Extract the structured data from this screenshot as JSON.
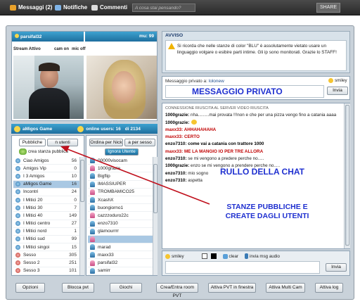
{
  "topbar": {
    "messaggi": "Messaggi (2)",
    "notifiche": "Notifiche",
    "commenti": "Commenti",
    "search_placeholder": "A cosa stai pensando?",
    "share": "SHARE"
  },
  "webcam": {
    "user1": "parsifal32",
    "user2": "mu: 99",
    "stream_label": "Stream Attivo",
    "cam_label": "cam on",
    "mic_label": "mic off"
  },
  "room_bar": {
    "room": "aMigos Game",
    "online_label": "online users: 16",
    "count": "di 2134"
  },
  "tabs": {
    "pubbliche": "Pubbliche",
    "utenti": "n utenti",
    "create_room": "crea stanza pubblica",
    "ordina_nick": "Ordina per Nick",
    "ordina_sesso": "a per sesso",
    "ignora": "Ignora Utente"
  },
  "rooms": [
    {
      "name": "Ciao Amigos",
      "count": "56"
    },
    {
      "name": "Amigos Vip",
      "count": "0"
    },
    {
      "name": "I 3 Amigos",
      "count": "10"
    },
    {
      "name": "aMigos Game",
      "count": "16"
    },
    {
      "name": "Incontri",
      "count": "24"
    },
    {
      "name": "I Mitici 20",
      "count": "0"
    },
    {
      "name": "I Mitici 30",
      "count": "7"
    },
    {
      "name": "I Mitici 40",
      "count": "149"
    },
    {
      "name": "I Mitici centro",
      "count": "27"
    },
    {
      "name": "I Mitici nord",
      "count": "1"
    },
    {
      "name": "I Mitici sud",
      "count": "99"
    },
    {
      "name": "I Mitici singoi",
      "count": "15"
    },
    {
      "name": "Sesso",
      "count": "305"
    },
    {
      "name": "Sesso 2",
      "count": "251"
    },
    {
      "name": "Sesso 3",
      "count": "101"
    }
  ],
  "users": [
    "00000visocam",
    "1000grazie",
    "Bigflip",
    "IMASSIUPER",
    "TROMBAMICO25",
    "XcashX",
    "buongiorno1",
    "cazzzoduro22c",
    "enzo7310",
    "glamourrrr",
    "",
    "marad",
    "maxx33",
    "parsifal32",
    "samirr"
  ],
  "avviso": {
    "title": "AVVISO",
    "text": "Si ricorda che nelle stanze di color \"BLU\" è assolutamente vietato usare un linguaggio volgare o esibire parti intime. Gli ip sono monitorati. Grazie lo STAFF!"
  },
  "private": {
    "label": "Messaggio privato a:",
    "to": "lolonew",
    "smiley": "smiley",
    "invia": "Invia",
    "overlay": "MESSAGGIO PRIVATO"
  },
  "chat": {
    "lines": [
      {
        "nick": "",
        "text": "CONNESSIONE RIUSCITA AL SERVER VIDEO RIUSCITA",
        "style": "sys"
      },
      {
        "nick": "1000grazie:",
        "text": " nha.........mai provata !!!non e che per una pizza vengo fino a catania aaaa",
        "style": "black"
      },
      {
        "nick": "1000grazie:",
        "text": "",
        "style": "black"
      },
      {
        "nick": "maxx33:",
        "text": " AHHAHAHAHA",
        "style": "red"
      },
      {
        "nick": "maxx33:",
        "text": " CERTO",
        "style": "red"
      },
      {
        "nick": "enzo7310:",
        "text": " come vai a catania con trattore 1000",
        "style": "bold"
      },
      {
        "nick": "maxx33:",
        "text": " ME LA MANGIO IO PER TRE ALLORA",
        "style": "red"
      },
      {
        "nick": "enzo7310:",
        "text": " se mi vengono a predere perche no.....",
        "style": "black"
      },
      {
        "nick": "1000grazie:",
        "text": " enzo se mi vengono a prendere perche no.....",
        "style": "black"
      },
      {
        "nick": "enzo7310:",
        "text": " mio sogno",
        "style": "black"
      },
      {
        "nick": "enzo7310:",
        "text": " aspetta",
        "style": "black"
      }
    ],
    "overlay": "RULLO DELLA CHAT",
    "smiley": "smiley",
    "clear": "clear",
    "invia_audio": "invia msg audio",
    "invia": "Invia"
  },
  "annotation": {
    "line1": "STANZE PUBBLICHE E",
    "line2": "CREATE DAGLI UTENTI"
  },
  "bottom_buttons": [
    "Opzioni",
    "Blocca pvt",
    "Giochi",
    "Crea/Entra room PVT",
    "Attiva PVT in finestra",
    "Attiva Multi Cam",
    "Attiva log"
  ],
  "colors": {
    "accent_blue": "#1f6f9e",
    "overlay_blue": "#1f30d0",
    "chat_red": "#c00000",
    "arrow": "#c0101c",
    "selected_row": "#a9c8e3"
  }
}
